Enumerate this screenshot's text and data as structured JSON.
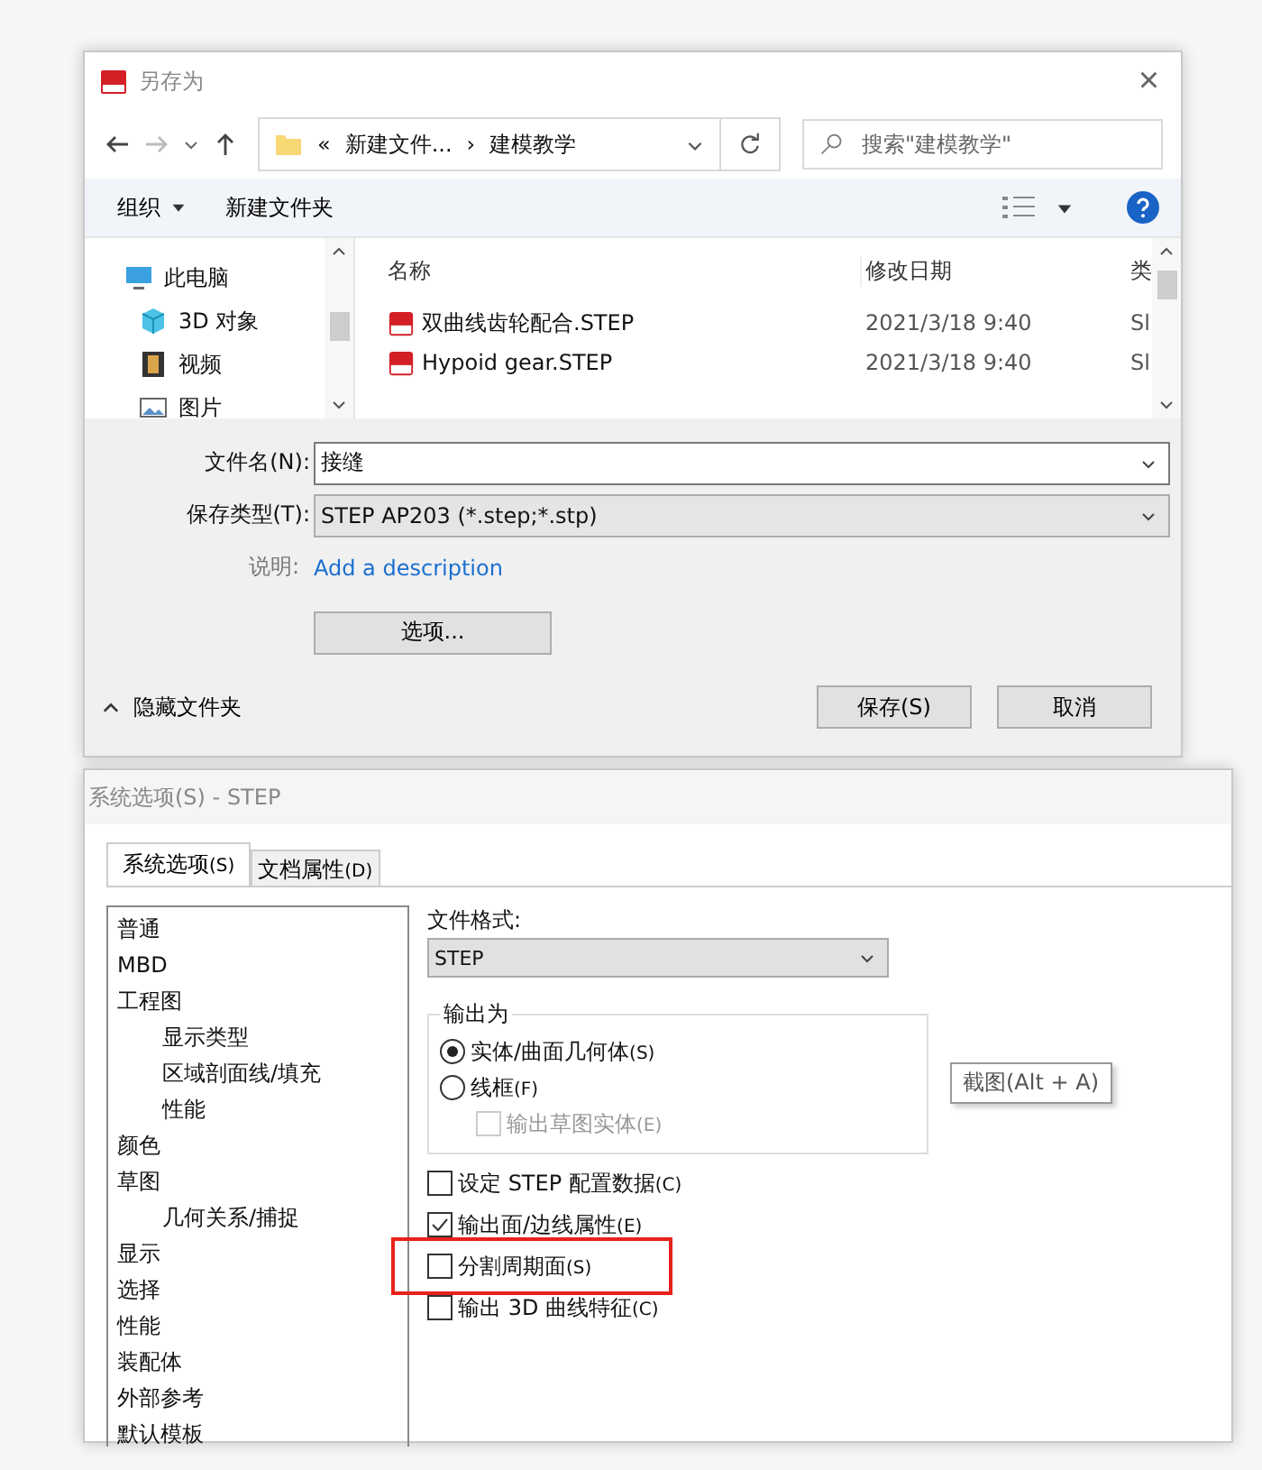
{
  "save_dialog": {
    "title": "另存为",
    "close": "×",
    "address": {
      "chevron": "«",
      "crumbs": [
        "新建文件...",
        "建模教学"
      ],
      "separator": "›"
    },
    "search": {
      "placeholder": "搜索\"建模教学\""
    },
    "toolbar": {
      "organize": "组织",
      "new_folder": "新建文件夹"
    },
    "nav_items": [
      {
        "label": "此电脑",
        "kind": "pc"
      },
      {
        "label": "3D 对象",
        "kind": "cube"
      },
      {
        "label": "视频",
        "kind": "film"
      },
      {
        "label": "图片",
        "kind": "image"
      }
    ],
    "columns": [
      "名称",
      "修改日期",
      "类"
    ],
    "files": [
      {
        "name": "双曲线齿轮配合.STEP",
        "date": "2021/3/18 9:40",
        "type": "Sl"
      },
      {
        "name": "Hypoid gear.STEP",
        "date": "2021/3/18 9:40",
        "type": "Sl"
      }
    ],
    "filename_label": "文件名(N):",
    "filename": "接缝",
    "type_label": "保存类型(T):",
    "type": "STEP AP203 (*.step;*.stp)",
    "desc_label": "说明:",
    "desc_link": "Add a description",
    "options_button": "选项...",
    "hide_folders": "隐藏文件夹",
    "buttons": [
      "保存(S)",
      "取消"
    ]
  },
  "options_dialog": {
    "title": "系统选项(S) - STEP",
    "tabs": [
      {
        "label": "系统选项",
        "key": "(S)",
        "selected": true
      },
      {
        "label": "文档属性",
        "key": "(D)",
        "selected": false
      }
    ],
    "tree": [
      {
        "label": "普通"
      },
      {
        "label": "MBD"
      },
      {
        "label": "工程图",
        "children": [
          {
            "label": "显示类型"
          },
          {
            "label": "区域剖面线/填充"
          },
          {
            "label": "性能"
          }
        ]
      },
      {
        "label": "颜色"
      },
      {
        "label": "草图",
        "children": [
          {
            "label": "几何关系/捕捉"
          }
        ]
      },
      {
        "label": "显示"
      },
      {
        "label": "选择"
      },
      {
        "label": "性能"
      },
      {
        "label": "装配体"
      },
      {
        "label": "外部参考"
      },
      {
        "label": "默认模板"
      }
    ],
    "format_label": "文件格式:",
    "format": "STEP",
    "group_label": "输出为",
    "group_options": [
      {
        "kind": "radio",
        "label": "实体/曲面几何体",
        "key": "(S)",
        "selected": true
      },
      {
        "kind": "radio",
        "label": "线框",
        "key": "(F)",
        "selected": false
      },
      {
        "kind": "checkbox",
        "label": "输出草图实体",
        "key": "(E)",
        "checked": false,
        "disabled": true
      }
    ],
    "options": [
      {
        "label": "设定 STEP 配置数据",
        "key": "(C)",
        "checked": false
      },
      {
        "label": "输出面/边线属性",
        "key": "(E)",
        "checked": true
      },
      {
        "label": "分割周期面",
        "key": "(S)",
        "checked": false,
        "highlighted": true
      },
      {
        "label": "输出 3D 曲线特征",
        "key": "(C)",
        "checked": false
      }
    ]
  },
  "tooltip": "截图(Alt + A)"
}
